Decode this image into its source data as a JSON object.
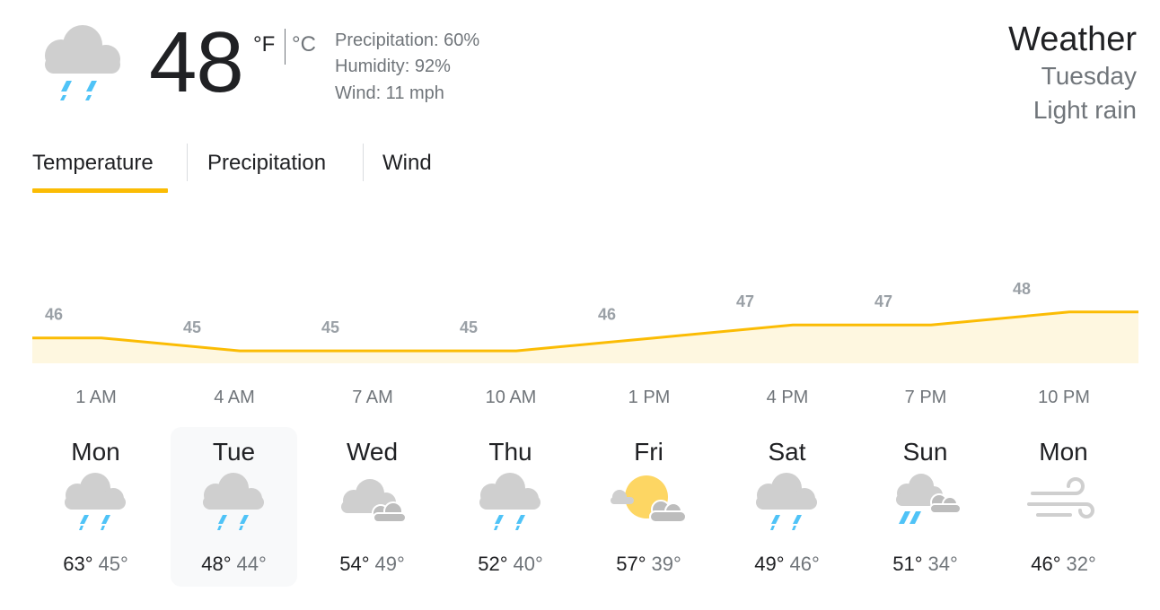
{
  "current": {
    "temperature": "48",
    "unit_f": "°F",
    "unit_c": "°C",
    "precipitation": "Precipitation: 60%",
    "humidity": "Humidity: 92%",
    "wind": "Wind: 11 mph",
    "icon": "rain-cloud-icon"
  },
  "header": {
    "title": "Weather",
    "day": "Tuesday",
    "condition": "Light rain"
  },
  "tabs": [
    {
      "label": "Temperature",
      "active": true
    },
    {
      "label": "Precipitation",
      "active": false
    },
    {
      "label": "Wind",
      "active": false
    }
  ],
  "colors": {
    "accent": "#fbbc04",
    "area_fill": "#fef7e0",
    "rain": "#4fc3f7",
    "cloud": "#cfcfcf",
    "sun": "#fdd663"
  },
  "chart_data": {
    "type": "area",
    "categories": [
      "1 AM",
      "4 AM",
      "7 AM",
      "10 AM",
      "1 PM",
      "4 PM",
      "7 PM",
      "10 PM"
    ],
    "values": [
      46,
      45,
      45,
      45,
      46,
      47,
      47,
      48
    ],
    "labels": [
      "46",
      "45",
      "45",
      "45",
      "46",
      "47",
      "47",
      "48"
    ]
  },
  "days": [
    {
      "name": "Mon",
      "high": "63°",
      "low": "45°",
      "icon": "rain-cloud-icon"
    },
    {
      "name": "Tue",
      "high": "48°",
      "low": "44°",
      "icon": "rain-cloud-icon",
      "selected": true
    },
    {
      "name": "Wed",
      "high": "54°",
      "low": "49°",
      "icon": "cloudy-icon"
    },
    {
      "name": "Thu",
      "high": "52°",
      "low": "40°",
      "icon": "rain-cloud-icon"
    },
    {
      "name": "Fri",
      "high": "57°",
      "low": "39°",
      "icon": "partly-sunny-icon"
    },
    {
      "name": "Sat",
      "high": "49°",
      "low": "46°",
      "icon": "rain-cloud-icon"
    },
    {
      "name": "Sun",
      "high": "51°",
      "low": "34°",
      "icon": "scattered-showers-icon"
    },
    {
      "name": "Mon",
      "high": "46°",
      "low": "32°",
      "icon": "windy-icon"
    }
  ]
}
